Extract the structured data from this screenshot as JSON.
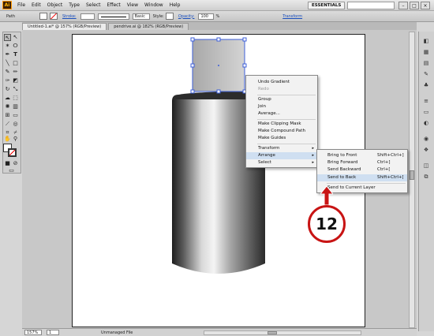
{
  "app": {
    "logo": "Ai"
  },
  "menubar": {
    "items": [
      "File",
      "Edit",
      "Object",
      "Type",
      "Select",
      "Effect",
      "View",
      "Window",
      "Help"
    ],
    "workspace": "ESSENTIALS",
    "window_buttons": [
      "–",
      "□",
      "×"
    ]
  },
  "controlbar": {
    "path_label": "Path",
    "stroke_link": "Stroke:",
    "brush_value": "Basic",
    "style_label": "Style:",
    "opacity_link": "Opacity:",
    "opacity_value": "100",
    "opacity_unit": "%",
    "transform_link": "Transform"
  },
  "tabs": [
    {
      "label": "Untitled-1.ai* @ 157% (RGB/Preview)",
      "active": true
    },
    {
      "label": "pendrive.ai @ 182% (RGB/Preview)",
      "active": false
    }
  ],
  "toolbar": {
    "tools": [
      "selection-tool",
      "direct-selection-tool",
      "magic-wand-tool",
      "lasso-tool",
      "pen-tool",
      "type-tool",
      "line-tool",
      "rectangle-tool",
      "paintbrush-tool",
      "pencil-tool",
      "blob-brush-tool",
      "eraser-tool",
      "rotate-tool",
      "scale-tool",
      "warp-tool",
      "free-transform-tool",
      "symbol-sprayer-tool",
      "graph-tool",
      "mesh-tool",
      "gradient-tool",
      "eyedropper-tool",
      "blend-tool",
      "live-paint-tool",
      "live-paint-selection-tool",
      "artboard-tool",
      "slice-tool",
      "hand-tool",
      "zoom-tool"
    ]
  },
  "context_menu": {
    "items": [
      {
        "label": "Undo Gradient",
        "enabled": true
      },
      {
        "label": "Redo",
        "enabled": false
      },
      {
        "label": "Group",
        "enabled": true
      },
      {
        "label": "Join",
        "enabled": true
      },
      {
        "label": "Average...",
        "enabled": true
      },
      {
        "label": "Make Clipping Mask",
        "enabled": true
      },
      {
        "label": "Make Compound Path",
        "enabled": true
      },
      {
        "label": "Make Guides",
        "enabled": true
      },
      {
        "label": "Transform",
        "enabled": true,
        "submenu": true
      },
      {
        "label": "Arrange",
        "enabled": true,
        "submenu": true,
        "highlighted": true
      },
      {
        "label": "Select",
        "enabled": true,
        "submenu": true
      }
    ],
    "submenu_arrow": "▸"
  },
  "arrange_submenu": {
    "items": [
      {
        "label": "Bring to Front",
        "shortcut": "Shift+Ctrl+]"
      },
      {
        "label": "Bring Forward",
        "shortcut": "Ctrl+]"
      },
      {
        "label": "Send Backward",
        "shortcut": "Ctrl+["
      },
      {
        "label": "Send to Back",
        "shortcut": "Shift+Ctrl+[",
        "highlighted": true
      },
      {
        "label": "Send to Current Layer",
        "shortcut": ""
      }
    ]
  },
  "step_badge": {
    "number": "12"
  },
  "statusbar": {
    "zoom": "157%",
    "artboard": "1",
    "status": "Unmanaged File"
  },
  "colors": {
    "selection": "#3d5fd8",
    "badge_ring": "#c81414",
    "menu_highlight": "#cfdff1"
  }
}
